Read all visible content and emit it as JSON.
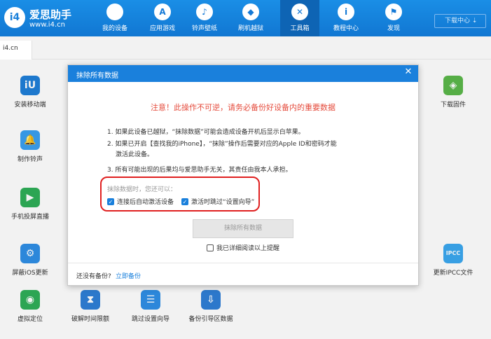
{
  "app": {
    "logo_badge": "i4",
    "name": "爱思助手",
    "url": "www.i4.cn",
    "download_center": "下载中心"
  },
  "nav": [
    {
      "label": "我的设备",
      "icon": "apple-icon",
      "glyph": ""
    },
    {
      "label": "应用游戏",
      "icon": "app-store-icon",
      "glyph": "A"
    },
    {
      "label": "铃声壁纸",
      "icon": "music-icon",
      "glyph": "♪"
    },
    {
      "label": "刷机越狱",
      "icon": "dropbox-icon",
      "glyph": "◆"
    },
    {
      "label": "工具箱",
      "icon": "toolbox-icon",
      "glyph": "✕"
    },
    {
      "label": "教程中心",
      "icon": "info-icon",
      "glyph": "i"
    },
    {
      "label": "发现",
      "icon": "flag-icon",
      "glyph": "⚑"
    }
  ],
  "nav_active_index": 4,
  "tab": {
    "label": "i4.cn"
  },
  "tools": [
    {
      "label": "安装移动端",
      "icon": "i4-app-icon",
      "glyph": "iU",
      "color": "#1f7fd8"
    },
    {
      "label": "制作铃声",
      "icon": "bell-icon",
      "glyph": "🔔",
      "color": "#3aa0f0"
    },
    {
      "label": "手机投屏直播",
      "icon": "screen-cast-icon",
      "glyph": "▶",
      "color": "#2fae58"
    },
    {
      "label": "屏蔽iOS更新",
      "icon": "gear-icon",
      "glyph": "⚙",
      "color": "#2f8fe6"
    },
    {
      "label": "虚拟定位",
      "icon": "location-pin-icon",
      "glyph": "◉",
      "color": "#2fae58"
    },
    {
      "label": "破解时间限额",
      "icon": "hourglass-icon",
      "glyph": "⧗",
      "color": "#2f7fd6"
    },
    {
      "label": "跳过设置向导",
      "icon": "checklist-icon",
      "glyph": "☰",
      "color": "#2f8fe6"
    },
    {
      "label": "备份引导区数据",
      "icon": "backup-icon",
      "glyph": "⇩",
      "color": "#2f7fd6"
    },
    {
      "label": "下载固件",
      "icon": "cube-icon",
      "glyph": "◈",
      "color": "#5bb84a"
    },
    {
      "label": "更新IPCC文件",
      "icon": "ipcc-icon",
      "glyph": "IPCC",
      "color": "#3ba8f0"
    }
  ],
  "dialog": {
    "title": "抹除所有数据",
    "warning": "注意！此操作不可逆，请务必备份好设备内的重要数据",
    "item1": "1. 如果此设备已越狱，“抹除数据”可能会造成设备开机后显示白苹果。",
    "item2_line1": "2. 如果已开启【查找我的iPhone】，“抹除”操作后需要对应的Apple ID和密码才能",
    "item2_line2": "激活此设备。",
    "item3": "3. 所有可能出现的后果均与爱思助手无关，其责任由我本人承担。",
    "options_hint": "抹除数据时，您还可以：",
    "option1": {
      "label": "连接后自动激活设备",
      "checked": true
    },
    "option2": {
      "label": "激活时跳过“设置向导”",
      "checked": true
    },
    "erase_button": "抹除所有数据",
    "confirm_label": "我已详细阅读以上提醒",
    "confirm_checked": false,
    "footer_question": "还没有备份?",
    "footer_link": "立即备份"
  }
}
